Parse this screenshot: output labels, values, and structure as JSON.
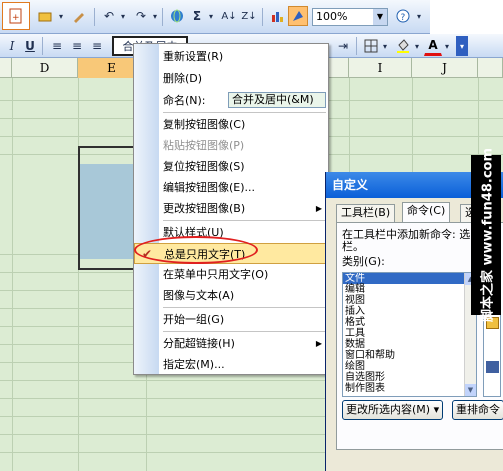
{
  "toolbar": {
    "zoom": "100%",
    "bold_label": "I",
    "underline_label": "U",
    "merge_label": "合并及居中",
    "sum_label": "Σ"
  },
  "sheet": {
    "columns": [
      {
        "label": "",
        "selected": false
      },
      {
        "label": "D",
        "selected": false
      },
      {
        "label": "E",
        "selected": true
      },
      {
        "label": "",
        "selected": false
      },
      {
        "label": "",
        "selected": false
      },
      {
        "label": "",
        "selected": false
      },
      {
        "label": "I",
        "selected": false
      },
      {
        "label": "J",
        "selected": false
      },
      {
        "label": "",
        "selected": false
      }
    ]
  },
  "context_menu": {
    "items": [
      {
        "label": "重新设置(R)",
        "disabled": false
      },
      {
        "label": "删除(D)",
        "disabled": false
      },
      {
        "label": "命名(N):",
        "disabled": false
      },
      {
        "label": "复制按钮图像(C)",
        "disabled": false
      },
      {
        "label": "粘贴按钮图像(P)",
        "disabled": true
      },
      {
        "label": "复位按钮图像(S)",
        "disabled": false
      },
      {
        "label": "编辑按钮图像(E)...",
        "disabled": false
      },
      {
        "label": "更改按钮图像(B)",
        "disabled": false
      },
      {
        "label": "默认样式(U)",
        "disabled": false
      },
      {
        "label": "总是只用文字(T)",
        "disabled": false
      },
      {
        "label": "在菜单中只用文字(O)",
        "disabled": false
      },
      {
        "label": "图像与文本(A)",
        "disabled": false
      },
      {
        "label": "开始一组(G)",
        "disabled": false
      },
      {
        "label": "分配超链接(H)",
        "disabled": false
      },
      {
        "label": "指定宏(M)...",
        "disabled": false
      }
    ],
    "name_value": "合并及居中(&M)"
  },
  "dialog": {
    "title": "自定义",
    "tabs": [
      "工具栏(B)",
      "命令(C)",
      "选"
    ],
    "instruction_line1": "在工具栏中添加新命令: 选",
    "instruction_line2": "栏。",
    "category_label": "类别(G):",
    "categories": [
      "文件",
      "编辑",
      "视图",
      "插入",
      "格式",
      "工具",
      "数据",
      "窗口和帮助",
      "绘图",
      "自选图形",
      "制作图表"
    ],
    "selected_category": "文件",
    "modify_button": "更改所选内容(M) ▾",
    "rearrange_button": "重排命令"
  },
  "watermark": {
    "text": "脚本之家 www.fun48.com"
  }
}
